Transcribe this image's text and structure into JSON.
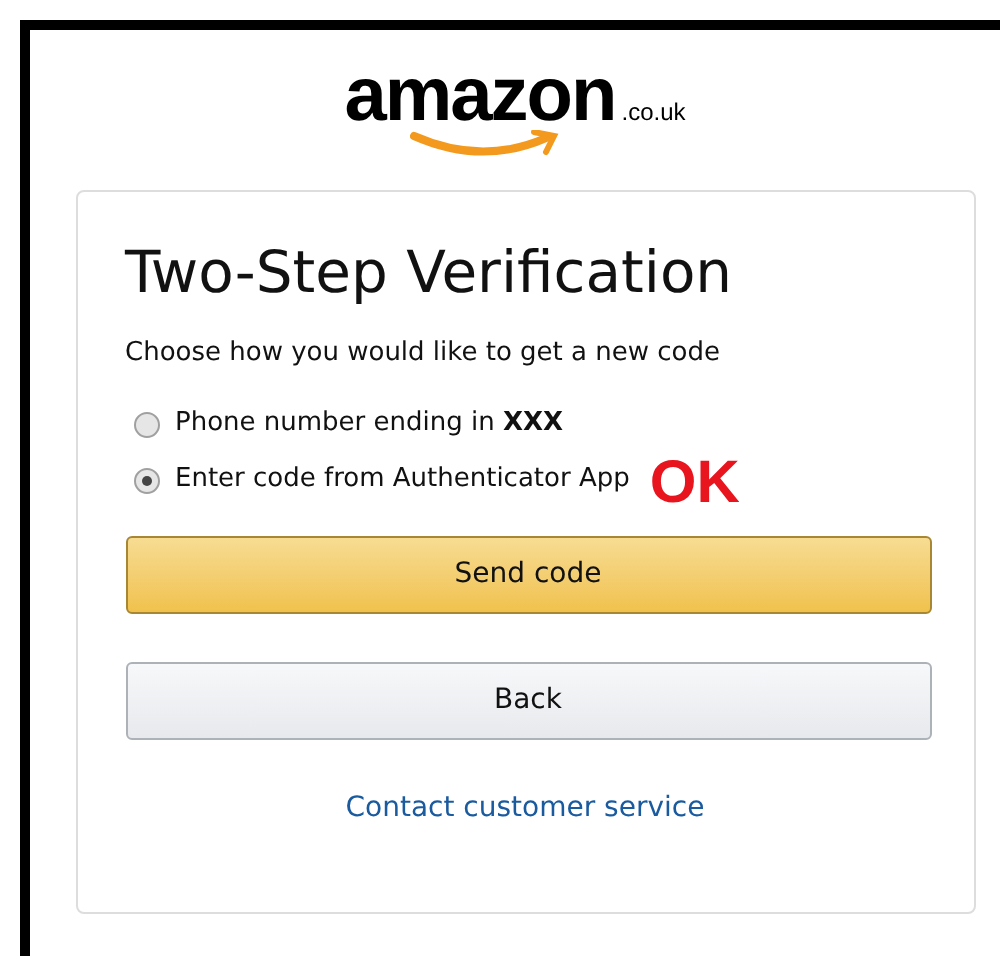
{
  "logo": {
    "wordmark": "amazon",
    "domain": ".co.uk"
  },
  "card": {
    "title": "Two-Step Verification",
    "prompt": "Choose how you would like to get a new code",
    "options": [
      {
        "label": "Phone number ending in **XXX**",
        "selected": false
      },
      {
        "label": "Enter code from Authenticator App",
        "selected": true
      }
    ],
    "annotation": "OK",
    "buttons": [
      {
        "label": "Send code",
        "kind": "primary"
      },
      {
        "label": "Back",
        "kind": "secondary"
      }
    ],
    "link": "Contact customer service"
  }
}
